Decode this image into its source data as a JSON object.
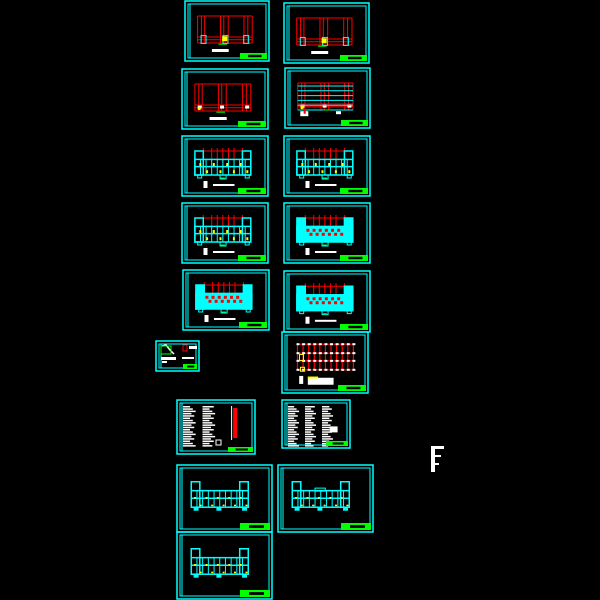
{
  "view": {
    "background": "#000000",
    "description": "CAD model space overview of structural drawing sheets"
  },
  "colors": {
    "frame": "#00ffff",
    "grid_axis": "#ff0000",
    "column": "#ffff00",
    "title_block": "#00ff00",
    "text": "#ffffff",
    "accent": "#ff00ff"
  },
  "sheets": [
    {
      "id": "sheet-1",
      "kind": "elevation-grid",
      "content": "foundation axis grid with columns"
    },
    {
      "id": "sheet-2",
      "kind": "elevation-grid",
      "content": "foundation axis grid with columns"
    },
    {
      "id": "sheet-3",
      "kind": "elevation-grid",
      "content": "axis grid with column markers"
    },
    {
      "id": "sheet-4",
      "kind": "plan-grid",
      "content": "beam layout plan with detail"
    },
    {
      "id": "sheet-5",
      "kind": "floor-plan",
      "content": "floor structural plan"
    },
    {
      "id": "sheet-6",
      "kind": "floor-plan",
      "content": "floor structural plan"
    },
    {
      "id": "sheet-7",
      "kind": "floor-plan",
      "content": "floor structural plan"
    },
    {
      "id": "sheet-8",
      "kind": "slab-plan",
      "content": "slab reinforcement plan"
    },
    {
      "id": "sheet-9",
      "kind": "slab-plan",
      "content": "slab reinforcement plan"
    },
    {
      "id": "sheet-10",
      "kind": "slab-plan",
      "content": "slab reinforcement plan"
    },
    {
      "id": "sheet-11",
      "kind": "detail",
      "content": "small stair detail"
    },
    {
      "id": "sheet-12",
      "kind": "column-plan",
      "content": "column layout plan"
    },
    {
      "id": "sheet-13",
      "kind": "notes",
      "content": "general notes with section"
    },
    {
      "id": "sheet-14",
      "kind": "notes",
      "content": "general notes text"
    },
    {
      "id": "sheet-15",
      "kind": "roof-plan",
      "content": "roof framing plan"
    },
    {
      "id": "sheet-16",
      "kind": "roof-plan",
      "content": "roof framing plan"
    },
    {
      "id": "sheet-17",
      "kind": "roof-plan",
      "content": "roof framing plan"
    }
  ],
  "loose_objects": [
    {
      "id": "stray-block",
      "content": "small white annotation block"
    }
  ]
}
